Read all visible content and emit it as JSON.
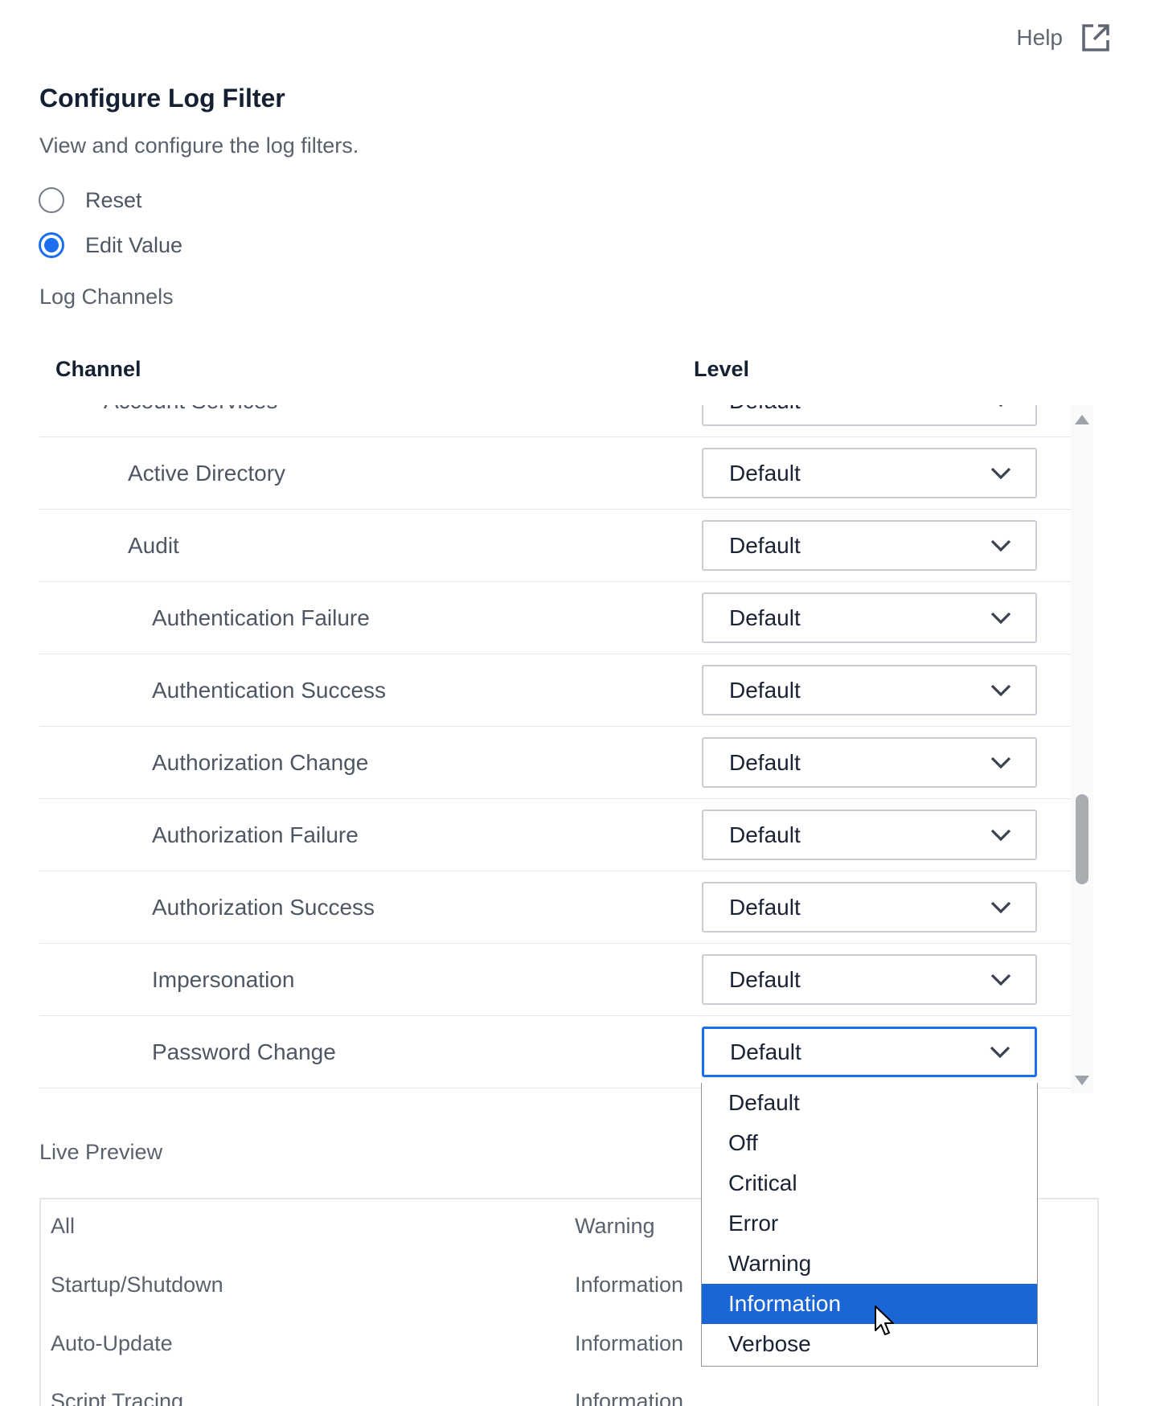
{
  "help": {
    "label": "Help",
    "icon": "external-link-icon"
  },
  "page": {
    "title": "Configure Log Filter",
    "description": "View and configure the log filters."
  },
  "radios": [
    {
      "label": "Reset",
      "checked": false
    },
    {
      "label": "Edit Value",
      "checked": true
    }
  ],
  "log_channels_label": "Log Channels",
  "table": {
    "headers": {
      "channel": "Channel",
      "level": "Level"
    },
    "rows": [
      {
        "channel": "Account Services",
        "level": "Default"
      },
      {
        "channel": "Active Directory",
        "level": "Default"
      },
      {
        "channel": "Audit",
        "level": "Default"
      },
      {
        "channel": "Authentication Failure",
        "level": "Default"
      },
      {
        "channel": "Authentication Success",
        "level": "Default"
      },
      {
        "channel": "Authorization Change",
        "level": "Default"
      },
      {
        "channel": "Authorization Failure",
        "level": "Default"
      },
      {
        "channel": "Authorization Success",
        "level": "Default"
      },
      {
        "channel": "Impersonation",
        "level": "Default"
      },
      {
        "channel": "Password Change",
        "level": "Default"
      }
    ]
  },
  "dropdown": {
    "options": [
      "Default",
      "Off",
      "Critical",
      "Error",
      "Warning",
      "Information",
      "Verbose"
    ],
    "highlighted": "Information"
  },
  "live_preview": {
    "label": "Live Preview",
    "rows": [
      {
        "name": "All",
        "level": "Warning"
      },
      {
        "name": "Startup/Shutdown",
        "level": "Information"
      },
      {
        "name": "Auto-Update",
        "level": "Information"
      },
      {
        "name": "Script Tracing",
        "level": "Information"
      }
    ]
  },
  "colors": {
    "accent": "#1b6ef0",
    "highlight": "#1a66d6",
    "title_text": "#162033",
    "body_text": "#4f5663",
    "border": "#c9ccd2"
  }
}
